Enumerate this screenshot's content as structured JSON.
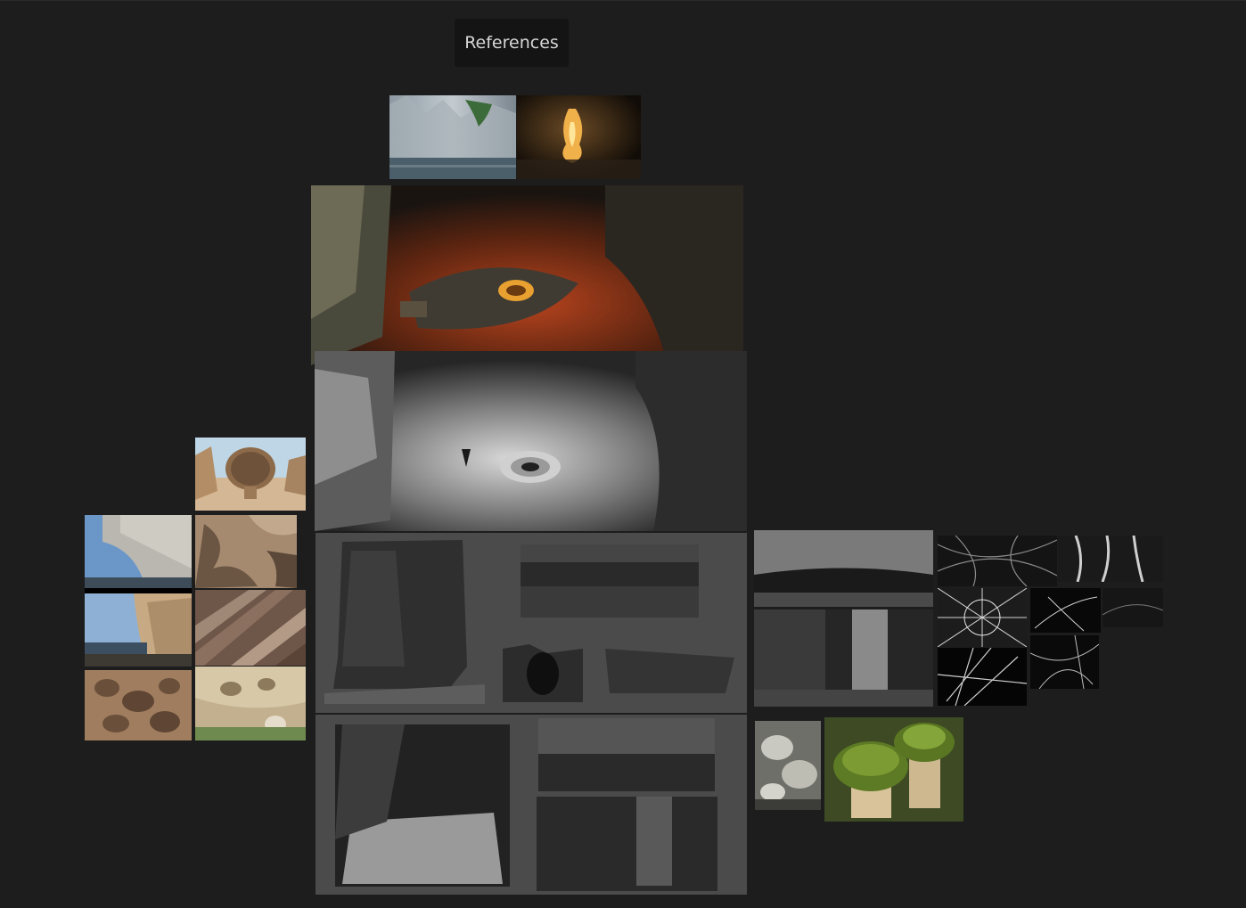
{
  "board": {
    "title": "References"
  },
  "colors": {
    "canvas_background": "#1d1d1d",
    "title_background": "#141414",
    "title_text": "#d6d6d6",
    "sheet_background": "#4a4a4a"
  },
  "references": [
    {
      "id": "cliff-lake-photo",
      "kind": "photo"
    },
    {
      "id": "glowing-cave-photo",
      "kind": "photo"
    },
    {
      "id": "lava-chamber-render",
      "kind": "render"
    },
    {
      "id": "grayscale-chamber-render",
      "kind": "render"
    },
    {
      "id": "honeycomb-boulder-photo",
      "kind": "photo"
    },
    {
      "id": "tafoni-overhang-photo",
      "kind": "photo"
    },
    {
      "id": "eroded-rock-photo",
      "kind": "photo"
    },
    {
      "id": "honeycomb-cliff-photo",
      "kind": "photo"
    },
    {
      "id": "striated-rock-photo",
      "kind": "photo"
    },
    {
      "id": "pitted-rock-photo",
      "kind": "photo"
    },
    {
      "id": "tafoni-ledge-photo",
      "kind": "photo"
    },
    {
      "id": "pillar-sketch-sheet",
      "kind": "sketch"
    },
    {
      "id": "cave-passage-sketch-sheet",
      "kind": "sketch"
    },
    {
      "id": "cave-mouth-sketch-a",
      "kind": "sketch"
    },
    {
      "id": "cave-mouth-sketch-b",
      "kind": "sketch"
    },
    {
      "id": "spiderweb-dense-photo",
      "kind": "photo"
    },
    {
      "id": "spiderweb-strands-photo",
      "kind": "photo"
    },
    {
      "id": "spiderweb-white-photo",
      "kind": "photo"
    },
    {
      "id": "spiderweb-dark-photo",
      "kind": "photo"
    },
    {
      "id": "spiderweb-faint-photo",
      "kind": "photo"
    },
    {
      "id": "spiderweb-corner-photo",
      "kind": "photo"
    },
    {
      "id": "spiderweb-tangle-photo",
      "kind": "photo"
    },
    {
      "id": "lichen-rock-photo",
      "kind": "photo"
    },
    {
      "id": "mossy-stones-photo",
      "kind": "photo"
    }
  ]
}
